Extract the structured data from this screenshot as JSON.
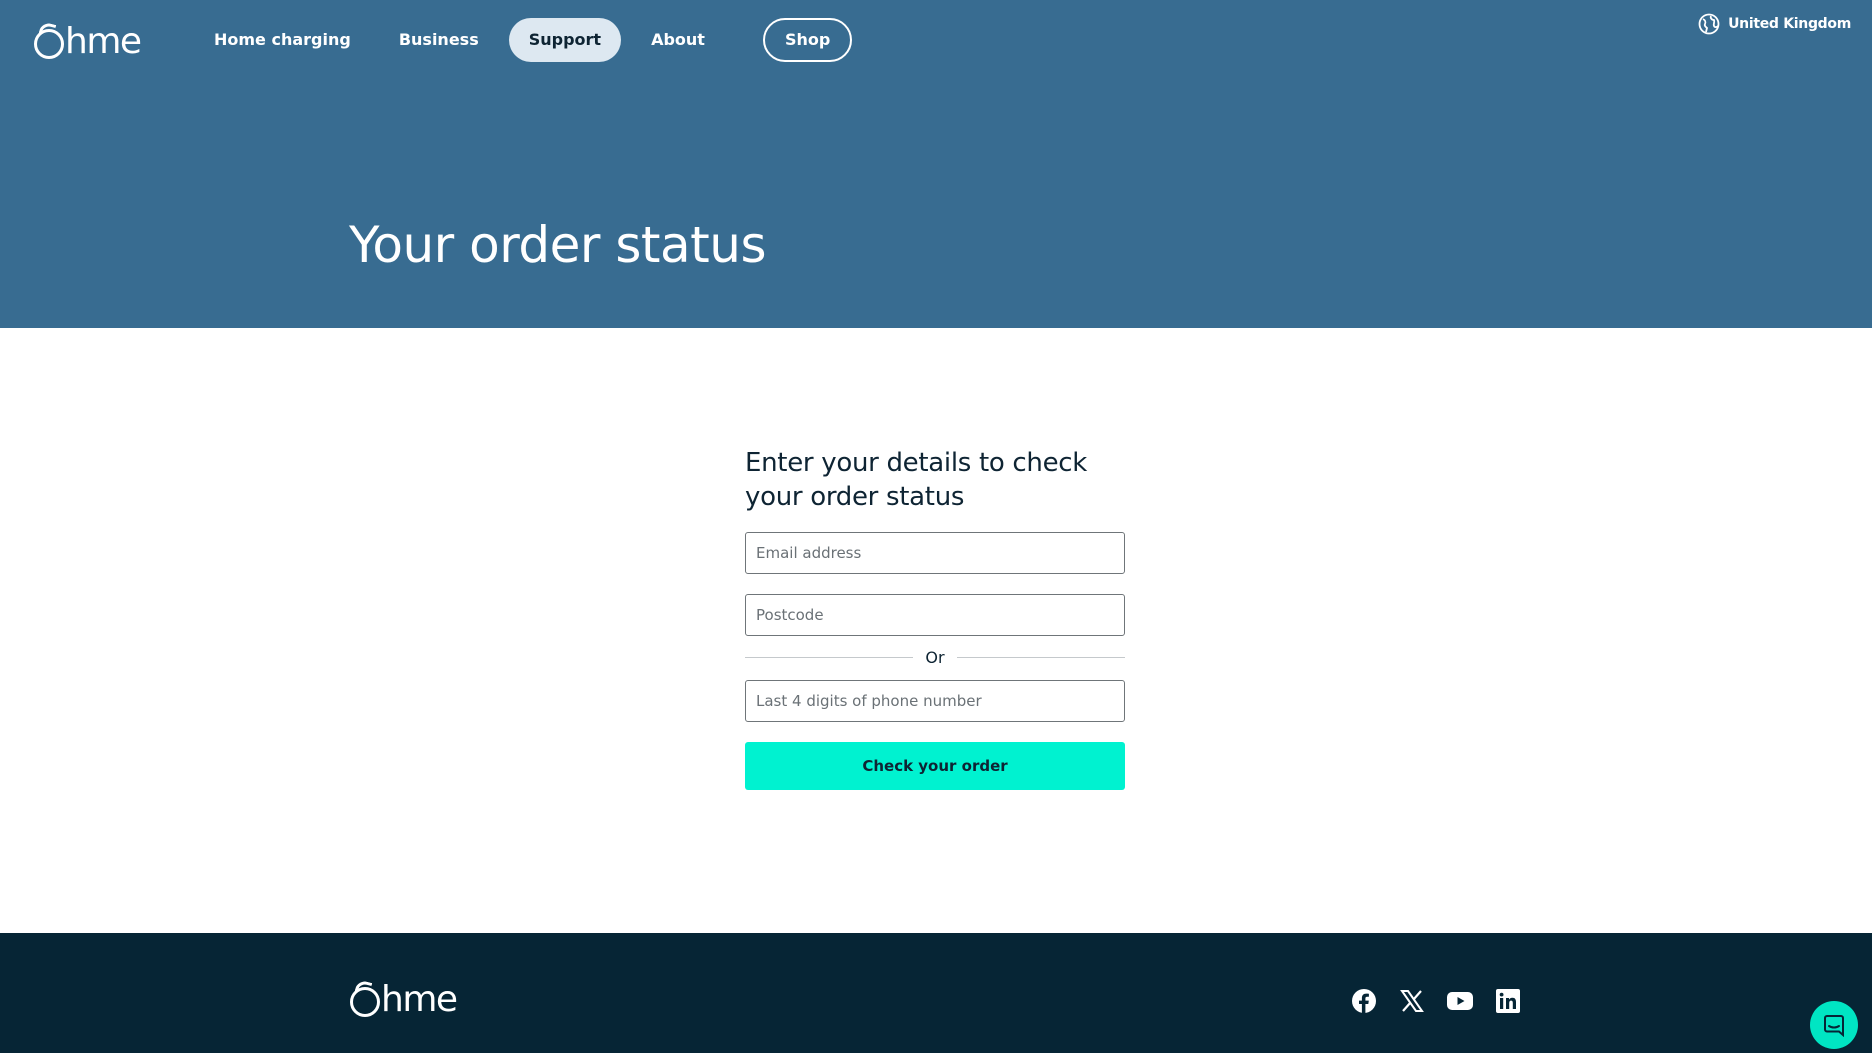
{
  "header": {
    "logo": "hme",
    "nav": [
      {
        "label": "Home charging"
      },
      {
        "label": "Business"
      },
      {
        "label": "Support",
        "active": true
      },
      {
        "label": "About"
      }
    ],
    "shop_label": "Shop",
    "region_label": "United Kingdom",
    "region_icon": "globe-icon"
  },
  "hero": {
    "title": "Your order status"
  },
  "form": {
    "heading": "Enter your details to check your order status",
    "email_placeholder": "Email address",
    "postcode_placeholder": "Postcode",
    "divider_label": "Or",
    "phone_placeholder": "Last 4 digits of phone number",
    "submit_label": "Check your order"
  },
  "footer": {
    "logo": "hme",
    "socials": [
      "facebook-icon",
      "x-icon",
      "youtube-icon",
      "linkedin-icon"
    ],
    "chat_icon": "chat-icon"
  },
  "colors": {
    "hero_bg": "#386c91",
    "accent": "#00f2d0",
    "footer_bg": "#062535",
    "text_dark": "#0e2433"
  }
}
